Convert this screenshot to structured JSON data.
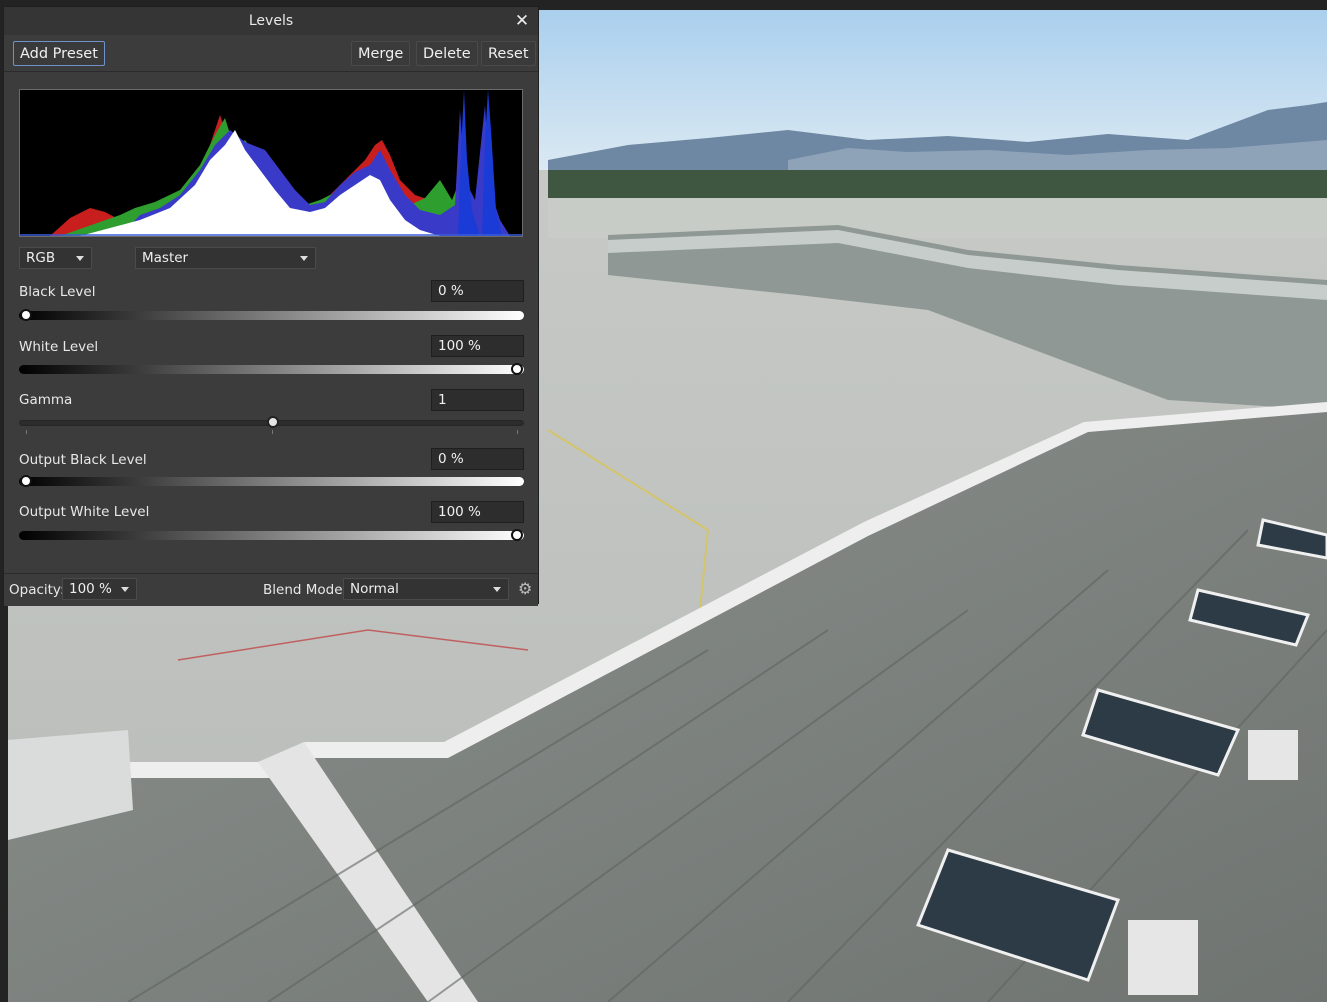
{
  "panel": {
    "title": "Levels",
    "buttons": {
      "add_preset": "Add Preset",
      "merge": "Merge",
      "delete": "Delete",
      "reset": "Reset"
    },
    "channel_dropdown": "RGB",
    "mode_dropdown": "Master",
    "sliders": {
      "black_level": {
        "label": "Black Level",
        "value": "0 %",
        "fraction": 0.0
      },
      "white_level": {
        "label": "White Level",
        "value": "100 %",
        "fraction": 1.0
      },
      "gamma": {
        "label": "Gamma",
        "value": "1",
        "fraction": 0.5
      },
      "output_black": {
        "label": "Output Black Level",
        "value": "0 %",
        "fraction": 0.0
      },
      "output_white": {
        "label": "Output White Level",
        "value": "100 %",
        "fraction": 1.0
      }
    },
    "footer": {
      "opacity_label": "Opacity:",
      "opacity_value": "100 %",
      "blend_label": "Blend Mode:",
      "blend_value": "Normal"
    }
  },
  "colors": {
    "accent": "#6f93c9",
    "panel_bg": "#3c3c3c"
  },
  "icons": {
    "close": "close-icon",
    "settings": "gear-icon"
  }
}
